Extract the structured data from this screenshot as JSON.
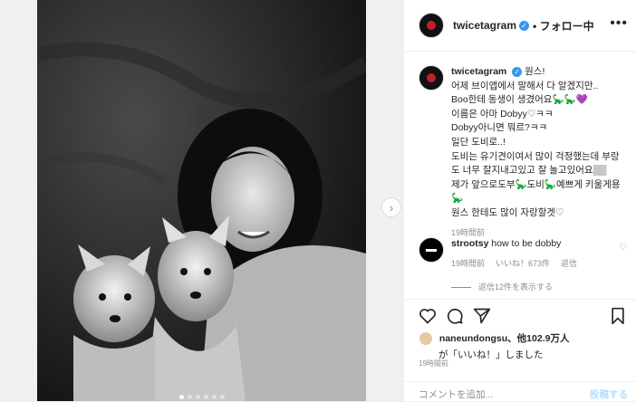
{
  "post": {
    "username": "twicetagram",
    "follow_label": "• フォロー中",
    "more_label": "•••",
    "caption_lines": [
      "원스!",
      "어제 브이앱에서 말해서 다 알겠지만..",
      "Boo한테 동생이 생겼어요🦕🦕💜",
      "이름은 아마 Dobyy♡ㅋㅋ",
      "Dobyy아니면 뭐르?ㅋㅋ",
      "일단 도비로..!",
      "도비는 유기견이여서 많이 걱정했는데 부랑",
      "도 너무 잘지내고있고 잘 놀고있어요▒▒",
      "제가 앞으로도부🦕도비🦕예쁘게 키울게용",
      "🦕",
      "원스 한테도 많이 자랑할겟♡"
    ],
    "caption_time": "19時間前",
    "comment": {
      "username": "strootsy",
      "text": "how to be dobby",
      "time": "19時間前",
      "likes": "いいね！673件",
      "reply": "返信",
      "view_replies": "返信12件を表示する"
    },
    "liked_by": {
      "user": "naneundongsu",
      "others": "、他102.9万人",
      "suffix": "が「いいね！」しました"
    },
    "post_time": "19時間前",
    "comment_placeholder": "コメントを追加...",
    "post_button": "投稿する",
    "next_arrow": "›"
  },
  "colors": {
    "brand_red": "#c0202a",
    "verified_blue": "#3897f0",
    "muted": "#8e8e8e",
    "post_button": "#b2dffc"
  },
  "carousel": {
    "count": 6,
    "active": 1
  }
}
